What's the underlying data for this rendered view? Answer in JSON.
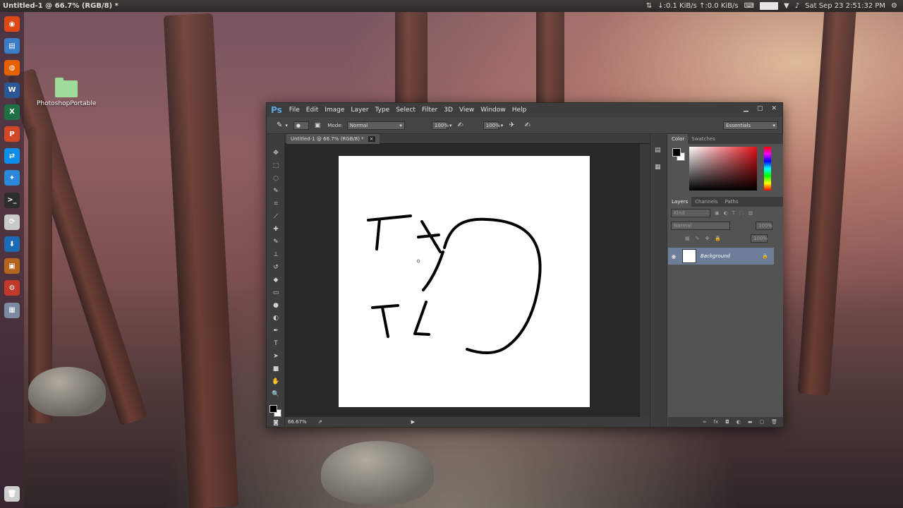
{
  "topbar": {
    "window_title": "Untitled-1 @ 66.7% (RGB/8) *",
    "network": "↓:0.1 KiB/s ↑:0.0 KiB/s",
    "datetime": "Sat Sep 23  2:51:32 PM",
    "icons": [
      "network-updown-icon",
      "keyboard-icon",
      "battery-icon",
      "wifi-icon",
      "volume-icon",
      "power-gear-icon"
    ]
  },
  "launcher": {
    "items": [
      {
        "name": "ubuntu-dash-icon",
        "color": "#dd4814",
        "glyph": "◉"
      },
      {
        "name": "files-icon",
        "color": "#3d7cc9",
        "glyph": "▤"
      },
      {
        "name": "firefox-icon",
        "color": "#e66000",
        "glyph": "◍"
      },
      {
        "name": "word-icon",
        "color": "#2b5797",
        "glyph": "W"
      },
      {
        "name": "excel-icon",
        "color": "#1e7145",
        "glyph": "X"
      },
      {
        "name": "powerpoint-icon",
        "color": "#d24726",
        "glyph": "P"
      },
      {
        "name": "teamviewer-icon",
        "color": "#0e8ee9",
        "glyph": "⇄"
      },
      {
        "name": "compass-icon",
        "color": "#2b88d8",
        "glyph": "✦"
      },
      {
        "name": "terminal-icon",
        "color": "#2c2c2c",
        "glyph": ">_"
      },
      {
        "name": "software-icon",
        "color": "#c9c9c9",
        "glyph": "⟳"
      },
      {
        "name": "installer-icon",
        "color": "#1c6cb5",
        "glyph": "⬇"
      },
      {
        "name": "archive-icon",
        "color": "#b5651d",
        "glyph": "▣"
      },
      {
        "name": "settings-icon",
        "color": "#c0392b",
        "glyph": "⚙"
      },
      {
        "name": "workspace-icon",
        "color": "#7a8aa0",
        "glyph": "▦"
      }
    ],
    "trash": {
      "name": "trash-icon",
      "glyph": "🗑"
    }
  },
  "desktop": {
    "icon_label": "PhotoshopPortable"
  },
  "ps": {
    "logo": "Ps",
    "menus": [
      "File",
      "Edit",
      "Image",
      "Layer",
      "Type",
      "Select",
      "Filter",
      "3D",
      "View",
      "Window",
      "Help"
    ],
    "options": {
      "mode_label": "Mode:",
      "mode_value": "Normal",
      "opacity": "100%",
      "flow": "100%",
      "workspace": "Essentials"
    },
    "doc_tab": "Untitled-1 @ 66.7% (RGB/8) *",
    "zoom_status": "66.67%",
    "color_tabs": [
      "Color",
      "Swatches"
    ],
    "layers_tabs": [
      "Layers",
      "Channels",
      "Paths"
    ],
    "layers": {
      "kind": "Kind",
      "blend": "Normal",
      "opacity": "100%",
      "fill": "100%",
      "layer_name": "Background"
    },
    "colors": {
      "fg": "#000000",
      "bg": "#ffffff",
      "accent": "#5aa9e6",
      "selected_layer": "#6d7e99"
    }
  }
}
